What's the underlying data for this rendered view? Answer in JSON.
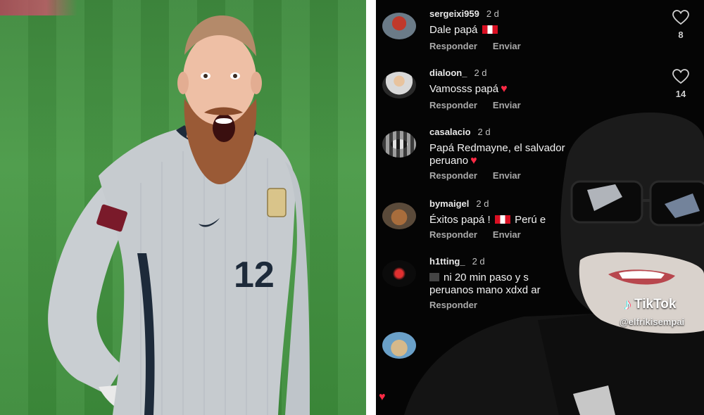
{
  "colors": {
    "pitch": "#4a9a47",
    "comment_bg": "#050505",
    "heart": "#ff2a45",
    "peru_red": "#d91023"
  },
  "photo": {
    "jersey_number": "12"
  },
  "comments": [
    {
      "username": "sergeixi959",
      "time": "2 d",
      "text": "Dale papá",
      "has_flag": true,
      "has_heart": false,
      "likes": "8",
      "reply_label": "Responder",
      "send_label": "Enviar"
    },
    {
      "username": "dialoon_",
      "time": "2 d",
      "text": "Vamosss papá",
      "has_flag": false,
      "has_heart": true,
      "likes": "14",
      "reply_label": "Responder",
      "send_label": "Enviar"
    },
    {
      "username": "casalacio",
      "time": "2 d",
      "text_line1": "Papá Redmayne, el salvador",
      "text_line2": "peruano",
      "has_heart": true,
      "reply_label": "Responder",
      "send_label": "Enviar"
    },
    {
      "username": "bymaigel",
      "time": "2 d",
      "text_before": "Éxitos papá !",
      "text_after": "Perú e",
      "reply_label": "Responder",
      "send_label": "Enviar"
    },
    {
      "username": "h1tting_",
      "time": "2 d",
      "text_line1": "ni 20 min paso y s",
      "text_line2": "peruanos mano xdxd ar",
      "reply_label": "Responder"
    }
  ],
  "watermark": {
    "brand": "TikTok",
    "handle": "@elfrikisempai"
  }
}
